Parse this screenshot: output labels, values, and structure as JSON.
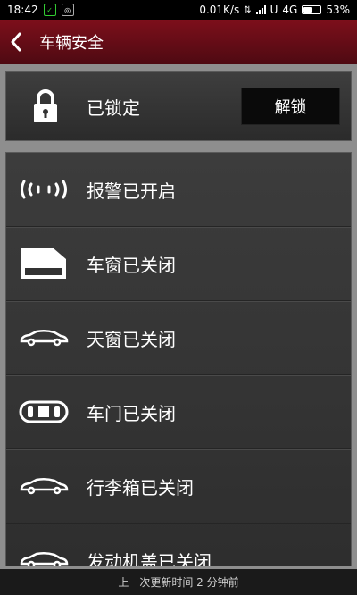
{
  "status_bar": {
    "time": "18:42",
    "network_speed": "0.01K/s",
    "network_type": "4G",
    "battery_percent": "53%",
    "battery_level": 0.53,
    "app_icons": [
      "wechat-icon",
      "message-icon"
    ]
  },
  "header": {
    "title": "车辆安全",
    "back_icon": "chevron-left-icon",
    "background": "#6b0d18"
  },
  "lock": {
    "label": "已锁定",
    "button_label": "解锁",
    "icon": "lock-icon"
  },
  "items": [
    {
      "label": "报警已开启",
      "icon": "alarm-waves-icon"
    },
    {
      "label": "车窗已关闭",
      "icon": "window-icon"
    },
    {
      "label": "天窗已关闭",
      "icon": "car-sunroof-icon"
    },
    {
      "label": "车门已关闭",
      "icon": "car-door-icon"
    },
    {
      "label": "行李箱已关闭",
      "icon": "car-trunk-icon"
    },
    {
      "label": "发动机盖已关闭",
      "icon": "car-hood-icon"
    }
  ],
  "footer": {
    "text": "上一次更新时间 2 分钟前"
  }
}
